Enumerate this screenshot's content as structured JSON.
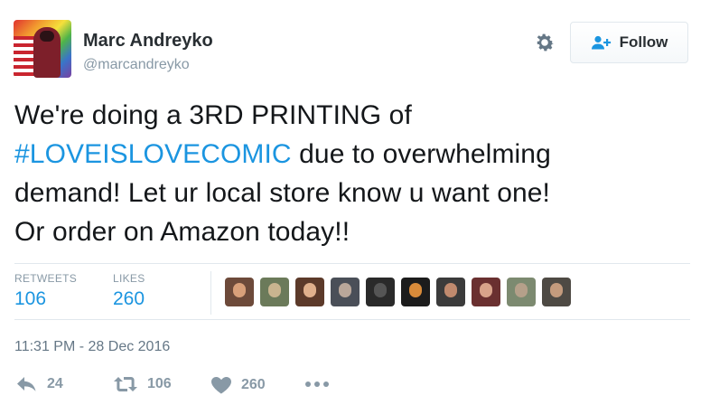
{
  "user": {
    "display_name": "Marc Andreyko",
    "handle": "@marcandreyko"
  },
  "header": {
    "settings_icon": "gear-icon",
    "follow_label": "Follow",
    "follow_icon": "person-plus-icon",
    "accent_color": "#1b95e0"
  },
  "tweet": {
    "text_line1": "We're doing a 3RD PRINTING of",
    "hashtag": "#LOVEISLOVECOMIC",
    "text_line2_rest": " due to overwhelming",
    "text_line3": "demand! Let ur local store know u want one!",
    "text_line4": "Or order on Amazon today!!"
  },
  "stats": {
    "retweets_label": "RETWEETS",
    "retweets_count": "106",
    "likes_label": "LIKES",
    "likes_count": "260"
  },
  "likers": [
    {
      "bg": "#6d4a3a",
      "head": "#d9a07a"
    },
    {
      "bg": "#6b7a5a",
      "head": "#c9b48f"
    },
    {
      "bg": "#5c3a2a",
      "head": "#e0b08c"
    },
    {
      "bg": "#4a4f58",
      "head": "#b9a79a"
    },
    {
      "bg": "#2a2a2a",
      "head": "#555555"
    },
    {
      "bg": "#1c1c1c",
      "head": "#d98b3a"
    },
    {
      "bg": "#3b3b3b",
      "head": "#c08a6e"
    },
    {
      "bg": "#6a3030",
      "head": "#d8a38a"
    },
    {
      "bg": "#7c8a70",
      "head": "#b5a08a"
    },
    {
      "bg": "#4e4a44",
      "head": "#c49b7d"
    }
  ],
  "timestamp": "11:31 PM - 28 Dec 2016",
  "actions": {
    "reply_count": "24",
    "retweet_count": "106",
    "like_count": "260",
    "more_icon": "more-dots-icon"
  }
}
